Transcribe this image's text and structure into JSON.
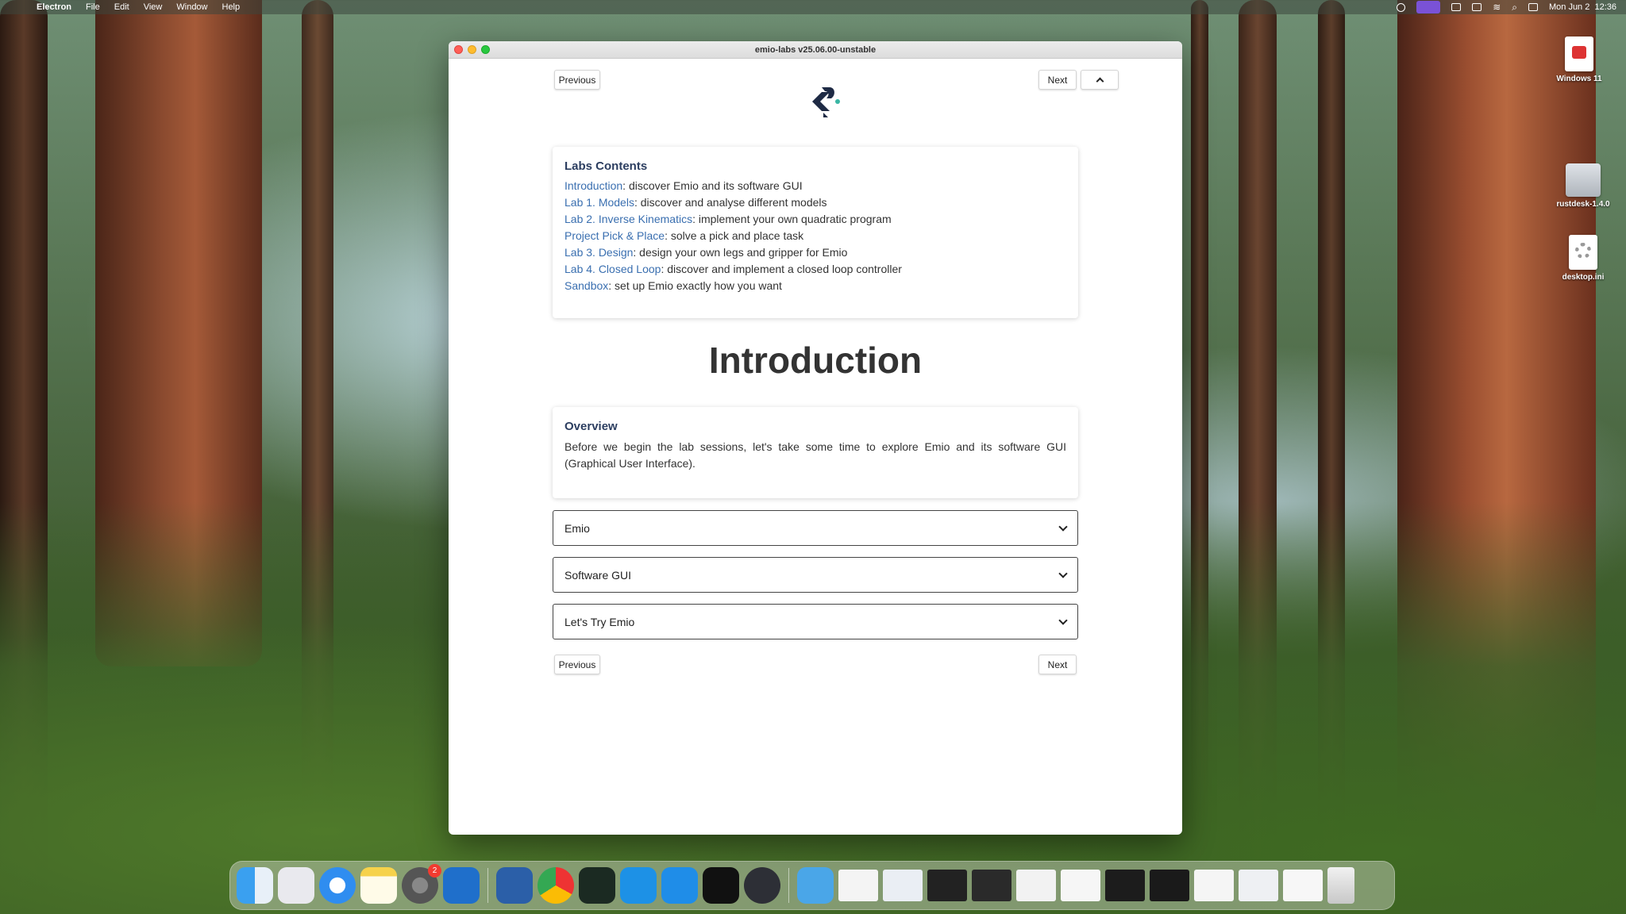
{
  "menubar": {
    "app_name": "Electron",
    "menus": [
      "File",
      "Edit",
      "View",
      "Window",
      "Help"
    ],
    "clock": "Mon Jun 2  12:36"
  },
  "desktop_icons": [
    {
      "label": "Windows 11"
    },
    {
      "label": "rustdesk-1.4.0"
    },
    {
      "label": "desktop.ini"
    }
  ],
  "window": {
    "title": "emio-labs v25.06.00-unstable",
    "top_nav": {
      "previous": "Previous",
      "next": "Next",
      "collapse": "^"
    },
    "labs_contents": {
      "heading": "Labs Contents",
      "items": [
        {
          "link": "Introduction",
          "text": ": discover Emio and its software GUI"
        },
        {
          "link": "Lab 1. Models",
          "text": ": discover and analyse different models"
        },
        {
          "link": "Lab 2. Inverse Kinematics",
          "text": ": implement your own quadratic program"
        },
        {
          "link": "Project Pick & Place",
          "text": ": solve a pick and place task"
        },
        {
          "link": "Lab 3. Design",
          "text": ": design your own legs and gripper for Emio"
        },
        {
          "link": "Lab 4. Closed Loop",
          "text": ": discover and implement a closed loop controller"
        },
        {
          "link": "Sandbox",
          "text": ": set up Emio exactly how you want"
        }
      ]
    },
    "page_title": "Introduction",
    "overview": {
      "heading": "Overview",
      "body": "Before we begin the lab sessions, let's take some time to explore Emio and its software GUI (Graphical User Interface)."
    },
    "sections": [
      "Emio",
      "Software GUI",
      "Let's Try Emio"
    ],
    "bottom_nav": {
      "previous": "Previous",
      "next": "Next"
    }
  },
  "dock": {
    "settings_badge": "2"
  },
  "colors": {
    "link": "#3a6fb0",
    "heading": "#2c3e60",
    "logo": "#1e2a44",
    "logo_dot": "#3ab6a4"
  }
}
